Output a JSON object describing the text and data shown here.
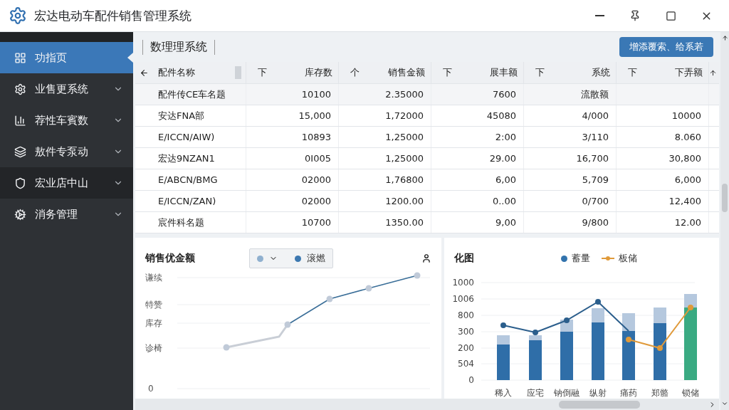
{
  "window": {
    "title": "宏达电动车配件销售管理系统"
  },
  "sidebar": {
    "items": [
      {
        "label": "功指页",
        "selected": true,
        "hovered": false,
        "expandable": false
      },
      {
        "label": "业售更系统",
        "selected": false,
        "hovered": false,
        "expandable": true
      },
      {
        "label": "荐性车賓数",
        "selected": false,
        "hovered": false,
        "expandable": true
      },
      {
        "label": "敖件专泵动",
        "selected": false,
        "hovered": false,
        "expandable": true
      },
      {
        "label": "宏业店中山",
        "selected": false,
        "hovered": true,
        "expandable": true
      },
      {
        "label": "消务管理",
        "selected": false,
        "hovered": false,
        "expandable": true
      }
    ]
  },
  "header": {
    "breadcrumb": "数理理系统",
    "button": "增添覆索、给系若"
  },
  "table": {
    "columns": [
      {
        "label": "配件名称"
      },
      {
        "sort": "下",
        "label": "库存数"
      },
      {
        "sort": "个",
        "label": "销售金额"
      },
      {
        "sort": "下",
        "label": "展丰额"
      },
      {
        "sort": "下",
        "label": "系统"
      },
      {
        "sort": "下",
        "label": "下弄额"
      }
    ],
    "rows": [
      [
        "配件传CE车名题",
        "10100",
        "2.35000",
        "7600",
        "流散额"
      ],
      [
        "安达FNA部",
        "15,000",
        "1,72000",
        "45080",
        "4/000",
        "10000"
      ],
      [
        "E/ICCN/AIW)",
        "10893",
        "1,25000",
        "2:00",
        "3/110",
        "8.060"
      ],
      [
        "宏达9NZAN1",
        "0I005",
        "1,25000",
        "29.00",
        "16,700",
        "30,800"
      ],
      [
        "E/ABCN/BMG",
        "02000",
        "1,76800",
        "6,00",
        "5,709",
        "6,000"
      ],
      [
        "E/ICCN/ZAN)",
        "02000",
        "1200.00",
        "0..00",
        "0/700",
        "12,400"
      ],
      [
        "宸件科名题",
        "10700",
        "1350.00",
        "9,00",
        "9/800",
        "12.00"
      ]
    ]
  },
  "line_chart": {
    "title": "销售优金额",
    "legend": "滚燃",
    "y_labels": [
      "谦续",
      "特赞",
      "库存",
      "诊椅",
      "0"
    ]
  },
  "bar_chart": {
    "title": "化图",
    "legend": [
      {
        "kind": "dot",
        "label": "蓄量"
      },
      {
        "kind": "line",
        "label": "板储"
      }
    ],
    "y_labels": [
      "1000",
      "1006",
      "800",
      "300",
      "200",
      "504",
      "0"
    ],
    "x_labels": [
      "稀入",
      "应宅",
      "钠倒融",
      "纵射",
      "痛药",
      "郑骼",
      "锁储"
    ]
  }
}
